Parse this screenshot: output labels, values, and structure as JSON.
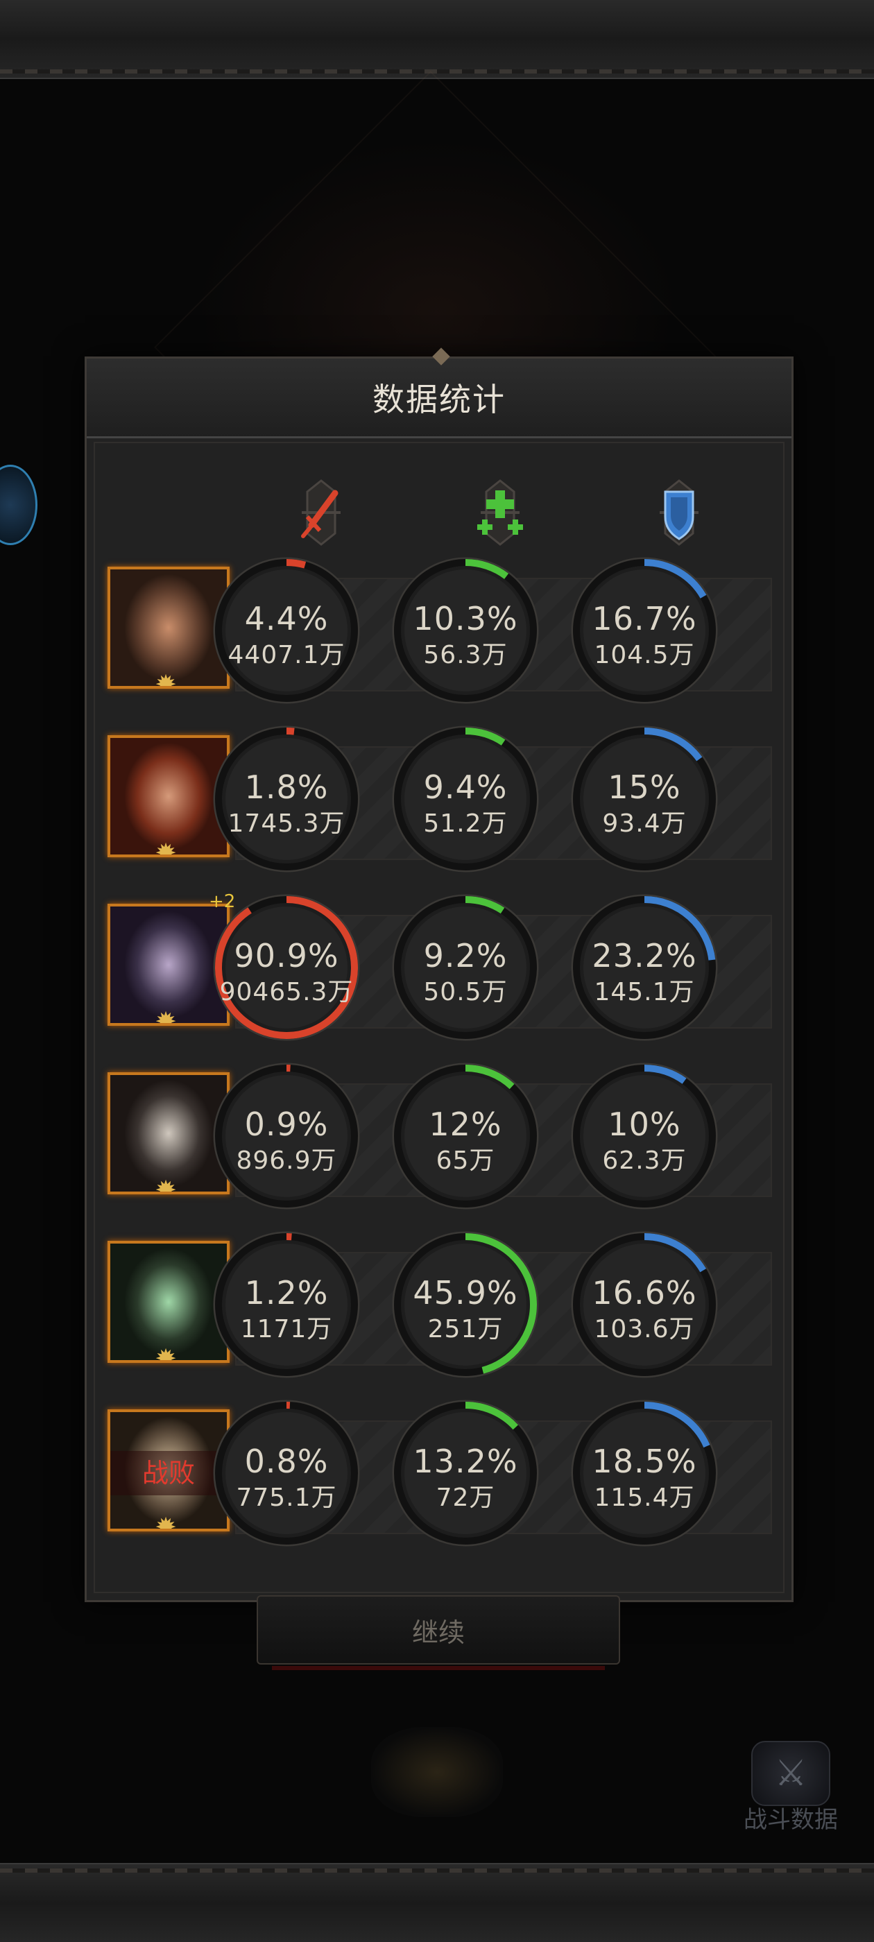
{
  "panel": {
    "title": "数据统计"
  },
  "columns": [
    {
      "name": "damage",
      "icon": "sword-icon",
      "color": "#d9432b"
    },
    {
      "name": "heal",
      "icon": "heal-cross-icon",
      "color": "#4cc23b"
    },
    {
      "name": "defense",
      "icon": "shield-icon",
      "color": "#3d80d0"
    }
  ],
  "heroes": [
    {
      "id": "hero-1",
      "defeated": false,
      "stats": [
        {
          "percent": "4.4%",
          "amount": "4407.1万",
          "fraction": 0.044
        },
        {
          "percent": "10.3%",
          "amount": "56.3万",
          "fraction": 0.103
        },
        {
          "percent": "16.7%",
          "amount": "104.5万",
          "fraction": 0.167
        }
      ]
    },
    {
      "id": "hero-2",
      "defeated": false,
      "stats": [
        {
          "percent": "1.8%",
          "amount": "1745.3万",
          "fraction": 0.018
        },
        {
          "percent": "9.4%",
          "amount": "51.2万",
          "fraction": 0.094
        },
        {
          "percent": "15%",
          "amount": "93.4万",
          "fraction": 0.15
        }
      ]
    },
    {
      "id": "hero-3",
      "defeated": false,
      "badge": "+2",
      "stats": [
        {
          "percent": "90.9%",
          "amount": "90465.3万",
          "fraction": 0.909
        },
        {
          "percent": "9.2%",
          "amount": "50.5万",
          "fraction": 0.092
        },
        {
          "percent": "23.2%",
          "amount": "145.1万",
          "fraction": 0.232
        }
      ]
    },
    {
      "id": "hero-4",
      "defeated": false,
      "stats": [
        {
          "percent": "0.9%",
          "amount": "896.9万",
          "fraction": 0.009
        },
        {
          "percent": "12%",
          "amount": "65万",
          "fraction": 0.12
        },
        {
          "percent": "10%",
          "amount": "62.3万",
          "fraction": 0.1
        }
      ]
    },
    {
      "id": "hero-5",
      "defeated": false,
      "stats": [
        {
          "percent": "1.2%",
          "amount": "1171万",
          "fraction": 0.012
        },
        {
          "percent": "45.9%",
          "amount": "251万",
          "fraction": 0.459
        },
        {
          "percent": "16.6%",
          "amount": "103.6万",
          "fraction": 0.166
        }
      ]
    },
    {
      "id": "hero-6",
      "defeated": true,
      "defeat_label": "战败",
      "stats": [
        {
          "percent": "0.8%",
          "amount": "775.1万",
          "fraction": 0.008
        },
        {
          "percent": "13.2%",
          "amount": "72万",
          "fraction": 0.132
        },
        {
          "percent": "18.5%",
          "amount": "115.4万",
          "fraction": 0.185
        }
      ]
    }
  ],
  "footer": {
    "continue_label": "继续",
    "battle_data_label": "战斗数据"
  }
}
